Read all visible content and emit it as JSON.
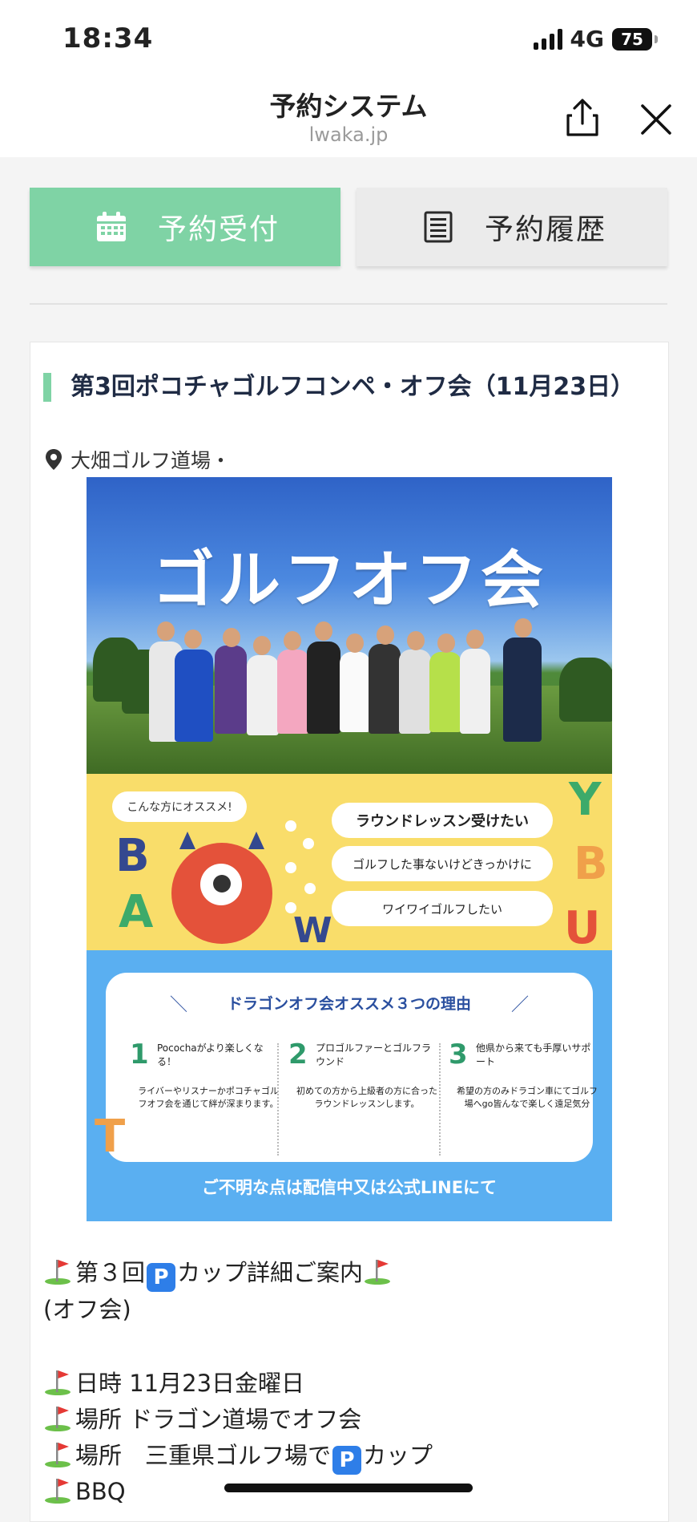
{
  "status_bar": {
    "time": "18:34",
    "network": "4G",
    "battery": "75"
  },
  "header": {
    "title": "予約システム",
    "domain": "lwaka.jp"
  },
  "tabs": [
    {
      "label": "予約受付",
      "icon": "calendar-icon",
      "active": true
    },
    {
      "label": "予約履歴",
      "icon": "list-icon",
      "active": false
    }
  ],
  "colors": {
    "accent": "#7fd3a5",
    "poster_yellow": "#f9dd6a",
    "poster_blue": "#5aaff1"
  },
  "event": {
    "title": "第3回ポコチャゴルフコンペ・オフ会（11月23日）",
    "location": "大畑ゴルフ道場・"
  },
  "poster": {
    "heading": "ゴルフオフ会",
    "bubble": "こんな方にオススメ!",
    "pills": [
      "ラウンドレッスン受けたい",
      "ゴルフした事ないけどきっかけに",
      "ワイワイゴルフしたい"
    ],
    "letters": [
      "B",
      "A",
      "W",
      "Y",
      "B",
      "U",
      "T"
    ],
    "reasons_title": "ドラゴンオフ会オススメ３つの理由",
    "reasons": [
      {
        "num": "1",
        "head": "Pocochaがより楽しくなる！",
        "body": "ライバーやリスナーかポコチャゴルフオフ会を通じて絆が深まります。"
      },
      {
        "num": "2",
        "head": "プロゴルファーとゴルフラウンド",
        "body": "初めての方から上級者の方に合ったラウンドレッスンします。"
      },
      {
        "num": "3",
        "head": "他県から来ても手厚いサポート",
        "body": "希望の方のみドラゴン車にてゴルフ場へgo皆んなで楽しく遠足気分"
      }
    ],
    "footer": "ご不明な点は配信中又は公式LINEにて"
  },
  "description": {
    "line1_a": "第３回",
    "line1_badge": "P",
    "line1_b": "カップ詳細ご案内",
    "line2": "(オフ会)",
    "items": [
      {
        "text": "日時 11月23日金曜日"
      },
      {
        "text": "場所 ドラゴン道場でオフ会"
      },
      {
        "text_a": "場所　三重県ゴルフ場で",
        "badge": "P",
        "text_b": "カップ"
      },
      {
        "text": "BBQ"
      }
    ]
  }
}
